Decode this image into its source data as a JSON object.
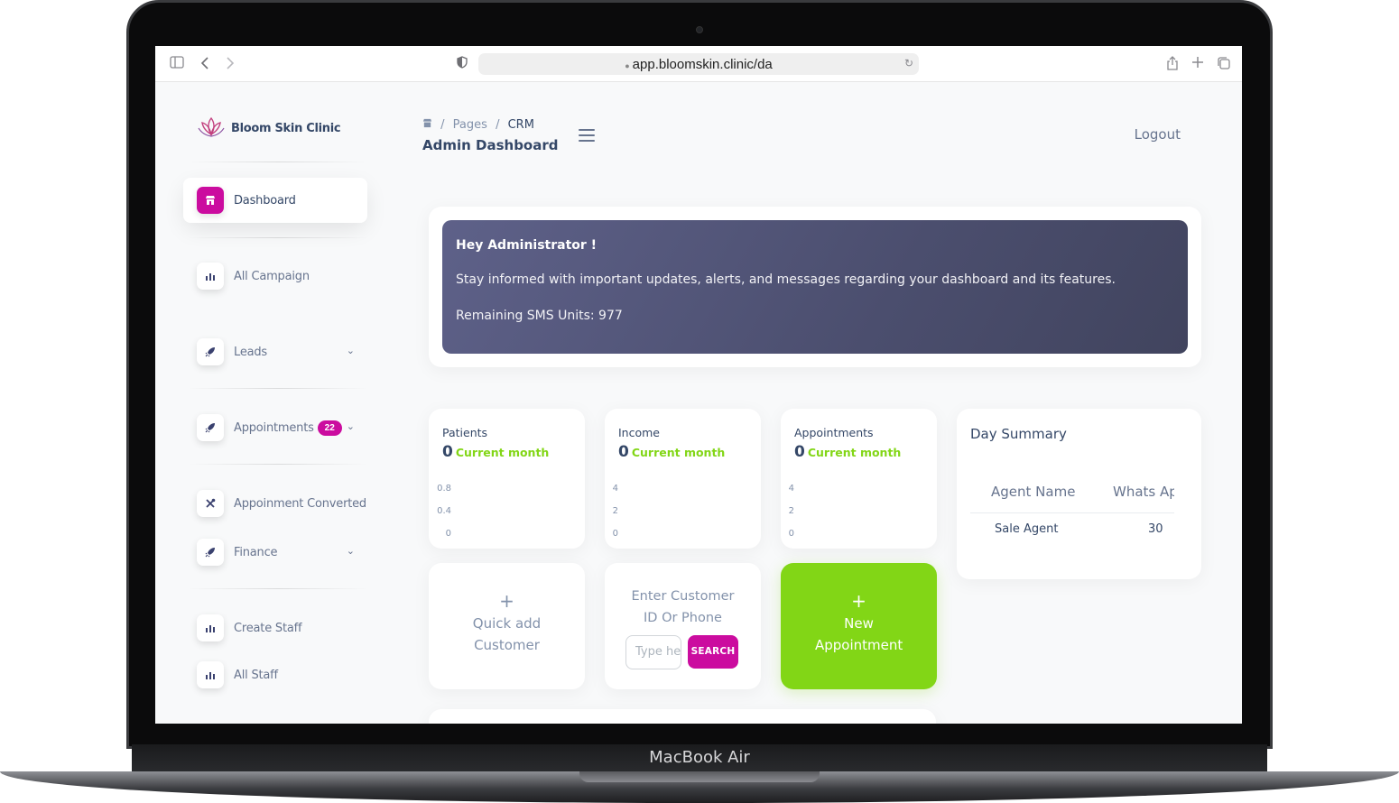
{
  "device": {
    "model": "MacBook Air"
  },
  "browser": {
    "url": "app.bloomskin.clinic/da",
    "icons": [
      "sidebar-toggle-icon",
      "back-icon",
      "forward-icon",
      "shield-icon",
      "reload-icon",
      "share-icon",
      "new-tab-icon",
      "tabs-icon"
    ]
  },
  "brand": {
    "name": "Bloom Skin Clinic",
    "accent": "#cb0c9f"
  },
  "sidebar": {
    "items": [
      {
        "label": "Dashboard",
        "icon": "shop-icon",
        "active": true
      },
      {
        "label": "All Campaign",
        "icon": "chart-icon"
      },
      {
        "label": "Leads",
        "icon": "rocket-icon",
        "has_chevron": true
      },
      {
        "label": "Appointments",
        "icon": "rocket-icon",
        "badge": "22",
        "has_chevron": true
      },
      {
        "label": "Appoinment Converted",
        "icon": "tools-icon"
      },
      {
        "label": "Finance",
        "icon": "rocket-icon",
        "has_chevron": true
      },
      {
        "label": "Create Staff",
        "icon": "chart-icon"
      },
      {
        "label": "All Staff",
        "icon": "chart-icon"
      }
    ]
  },
  "header": {
    "breadcrumb": {
      "home_icon": "shop-icon",
      "sep": "/",
      "pages": "Pages",
      "current": "CRM"
    },
    "title": "Admin Dashboard",
    "logout": "Logout"
  },
  "welcome": {
    "greeting": "Hey Administrator !",
    "message": "Stay informed with important updates, alerts, and messages regarding your dashboard and its features.",
    "sms": "Remaining SMS Units: 977"
  },
  "stats": [
    {
      "label": "Patients",
      "value": "0",
      "sub": "Current month",
      "ticks": [
        "0.8",
        "0.4",
        "0"
      ]
    },
    {
      "label": "Income",
      "value": "0",
      "sub": "Current month",
      "ticks": [
        "4",
        "2",
        "0"
      ]
    },
    {
      "label": "Appointments",
      "value": "0",
      "sub": "Current month",
      "ticks": [
        "4",
        "2",
        "0"
      ]
    }
  ],
  "actions": {
    "quick_add": {
      "plus": "+",
      "label": "Quick add Customer"
    },
    "search": {
      "title": "Enter Customer ID Or Phone",
      "placeholder": "Type here...",
      "button": "SEARCH"
    },
    "new_appointment": {
      "plus": "+",
      "label": "New Appointment",
      "color": "#82d616"
    }
  },
  "day_summary": {
    "title": "Day Summary",
    "columns": [
      "Agent Name",
      "Whats App"
    ],
    "rows": [
      {
        "agent": "Sale Agent",
        "value": "30"
      }
    ]
  }
}
